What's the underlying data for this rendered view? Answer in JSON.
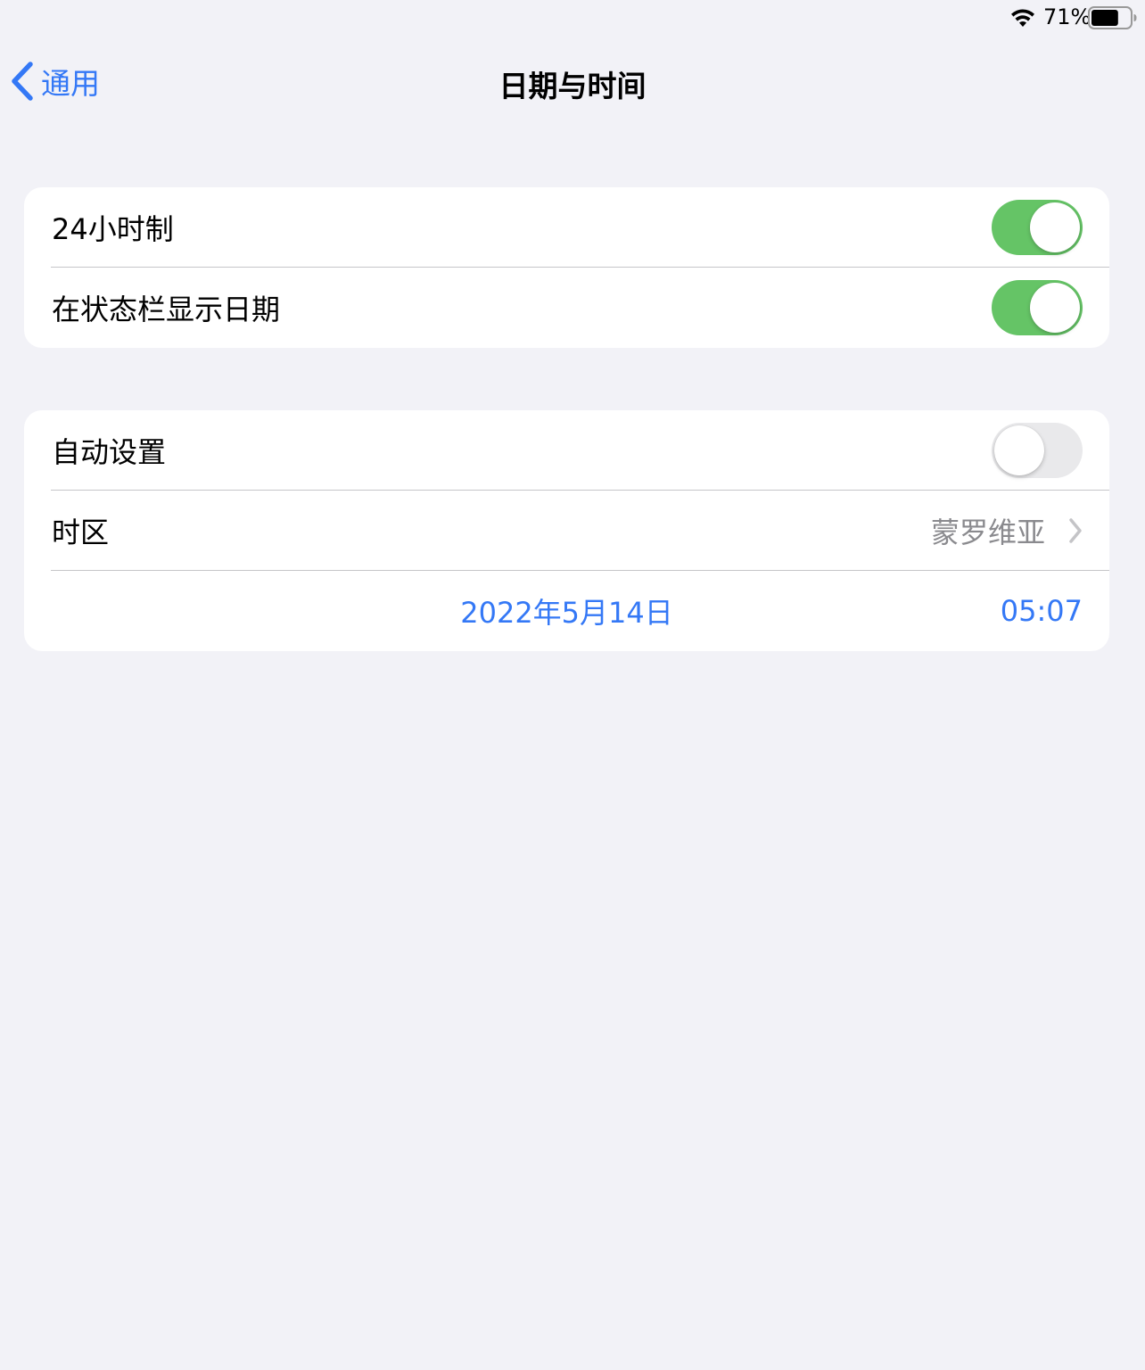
{
  "status_bar": {
    "battery_percent": "71%",
    "battery_level": 0.71,
    "icons": [
      "wifi-icon",
      "battery-icon"
    ]
  },
  "nav": {
    "back_label": "通用",
    "title": "日期与时间"
  },
  "group1": {
    "rows": [
      {
        "label": "24小时制",
        "toggle_on": true
      },
      {
        "label": "在状态栏显示日期",
        "toggle_on": true
      }
    ]
  },
  "group2": {
    "auto_set": {
      "label": "自动设置",
      "toggle_on": false
    },
    "timezone": {
      "label": "时区",
      "value": "蒙罗维亚"
    },
    "datetime": {
      "date": "2022年5月14日",
      "time": "05:07"
    }
  },
  "colors": {
    "accent": "#3478f6",
    "toggle_on": "#65c466",
    "toggle_off": "#e9e9eb",
    "background": "#f2f2f7"
  }
}
